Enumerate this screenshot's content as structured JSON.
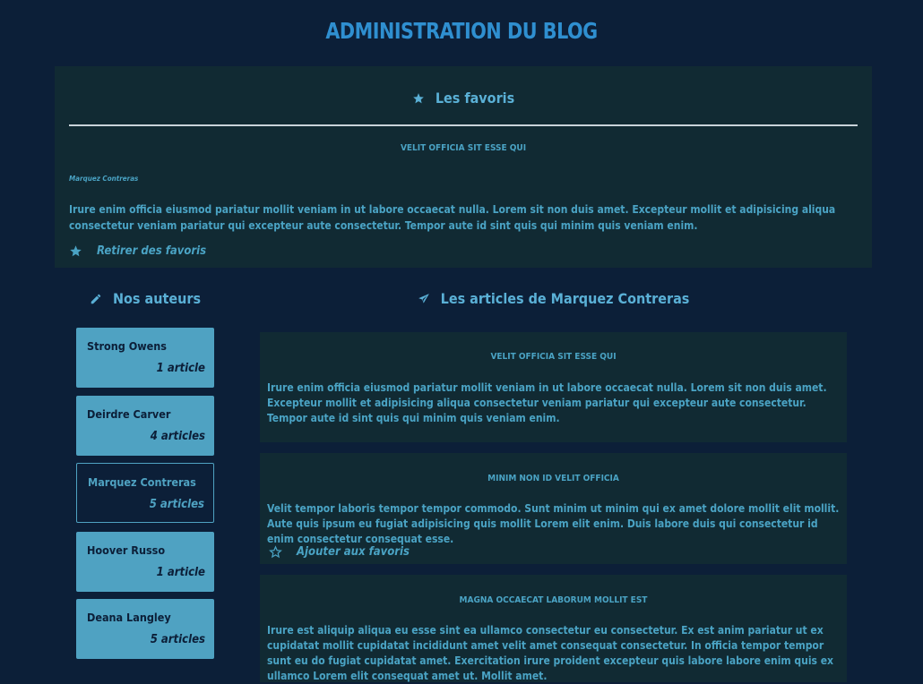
{
  "page": {
    "title": "ADMINISTRATION DU BLOG"
  },
  "favorites": {
    "heading": "Les favoris",
    "article": {
      "title": "VELIT OFFICIA SIT ESSE QUI",
      "author": "Marquez Contreras",
      "body": "Irure enim officia eiusmod pariatur mollit veniam in ut labore occaecat nulla. Lorem sit non duis amet. Excepteur mollit et adipisicing aliqua consectetur veniam pariatur qui excepteur aute consectetur. Tempor aute id sint quis qui minim quis veniam enim.",
      "action_label": "Retirer des favoris",
      "action_icon": "star-filled-icon"
    }
  },
  "authors": {
    "heading": "Nos auteurs",
    "heading_icon": "pencil-icon",
    "items": [
      {
        "name": "Strong Owens",
        "count": "1 article",
        "active": false
      },
      {
        "name": "Deirdre Carver",
        "count": "4 articles",
        "active": false
      },
      {
        "name": "Marquez Contreras",
        "count": "5 articles",
        "active": true
      },
      {
        "name": "Hoover Russo",
        "count": "1 article",
        "active": false
      },
      {
        "name": "Deana Langley",
        "count": "5 articles",
        "active": false
      }
    ]
  },
  "articles": {
    "heading": "Les articles de Marquez Contreras",
    "heading_icon": "paper-plane-icon",
    "items": [
      {
        "title": "VELIT OFFICIA SIT ESSE QUI",
        "body": "Irure enim officia eiusmod pariatur mollit veniam in ut labore occaecat nulla. Lorem sit non duis amet. Excepteur mollit et adipisicing aliqua consectetur veniam pariatur qui excepteur aute consectetur. Tempor aute id sint quis qui minim quis veniam enim."
      },
      {
        "title": "MINIM NON ID VELIT OFFICIA",
        "body": "Velit tempor laboris tempor tempor commodo. Sunt minim ut minim qui ex amet dolore mollit elit mollit. Aute quis ipsum eu fugiat adipisicing quis mollit Lorem elit enim. Duis labore duis qui consectetur id enim consectetur consequat esse.",
        "action_label": "Ajouter aux favoris",
        "action_icon": "star-outline-icon"
      },
      {
        "title": "MAGNA OCCAECAT LABORUM MOLLIT EST",
        "body": "Irure est aliquip aliqua eu esse sint ea ullamco consectetur eu consectetur. Ex est anim pariatur ut ex cupidatat mollit cupidatat incididunt amet velit amet consequat consectetur. In officia tempor tempor sunt eu do fugiat cupidatat amet. Exercitation irure proident excepteur quis labore labore enim quis ex ullamco Lorem elit consequat amet ut. Mollit amet."
      }
    ]
  },
  "colors": {
    "background": "#0c1f38",
    "panel": "#112a33",
    "accent": "#4fa2c2",
    "title": "#2f8fd0"
  }
}
